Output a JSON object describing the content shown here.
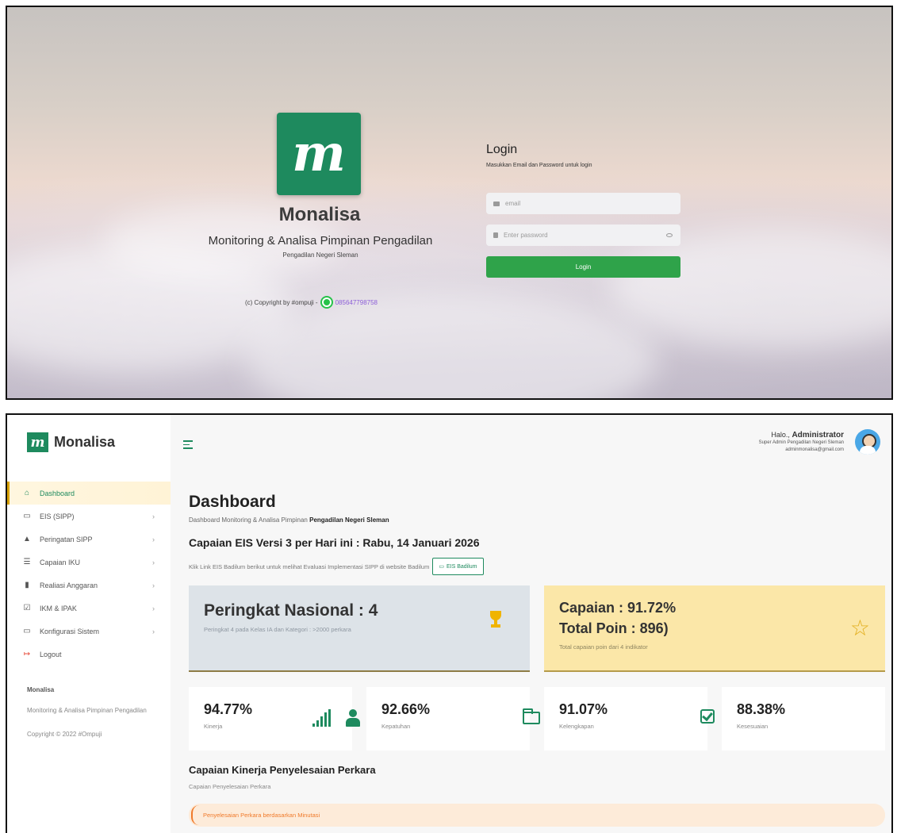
{
  "login": {
    "logo_letter": "m",
    "brand_name": "Monalisa",
    "brand_tagline": "Monitoring & Analisa Pimpinan Pengadilan",
    "court_name": "Pengadilan Negeri Sleman",
    "copyright_text": "(c) Copyright by #ompuji -",
    "phone": "085647798758",
    "title": "Login",
    "description": "Masukkan Email dan Password untuk login",
    "email_placeholder": "email",
    "password_placeholder": "Enter password",
    "submit_label": "Login",
    "colors": {
      "brand": "#1e8a5e",
      "button": "#2fa34a",
      "whatsapp": "#27c24a"
    }
  },
  "dashboard": {
    "sidebar": {
      "logo_letter": "m",
      "logo_text": "Monalisa",
      "items": [
        {
          "label": "Dashboard",
          "icon": "home-icon",
          "glyph": "⌂",
          "active": true,
          "chevron": ""
        },
        {
          "label": "EIS (SIPP)",
          "icon": "monitor-icon",
          "glyph": "▭",
          "active": false,
          "chevron": "›"
        },
        {
          "label": "Peringatan SIPP",
          "icon": "warning-icon",
          "glyph": "▲",
          "active": false,
          "chevron": "›"
        },
        {
          "label": "Capaian IKU",
          "icon": "list-icon",
          "glyph": "☰",
          "active": false,
          "chevron": "›"
        },
        {
          "label": "Realiasi Anggaran",
          "icon": "bar-chart-icon",
          "glyph": "▮",
          "active": false,
          "chevron": "›"
        },
        {
          "label": "IKM & IPAK",
          "icon": "checkbox-icon",
          "glyph": "☑",
          "active": false,
          "chevron": "›"
        },
        {
          "label": "Konfigurasi Sistem",
          "icon": "monitor-icon",
          "glyph": "▭",
          "active": false,
          "chevron": "›"
        },
        {
          "label": "Logout",
          "icon": "logout-icon",
          "glyph": "↦",
          "active": false,
          "chevron": ""
        }
      ],
      "footer_title": "Monalisa",
      "footer_desc": "Monitoring & Analisa Pimpinan Pengadilan",
      "footer_copy": "Copyright © 2022 #Ompuji"
    },
    "header": {
      "greeting_prefix": "Halo.,",
      "user_name": "Administrator",
      "role": "Super Admin Pengadilan Negeri Sleman",
      "email": "adminmonalisa@gmail.com"
    },
    "page_title": "Dashboard",
    "page_sub_prefix": "Dashboard Monitoring & Analisa Pimpinan",
    "page_sub_court": "Pengadilan Negeri Sleman",
    "eis_title": "Capaian EIS Versi 3 per Hari ini : Rabu, 14 Januari 2026",
    "eis_desc": "Klik Link EIS Badilum berikut untuk melihat Evaluasi Implementasi SIPP di website Badilum",
    "eis_button": "EIS Badilum",
    "rank_card": {
      "title": "Peringkat Nasional : 4",
      "desc": "Peringkat 4 pada Kelas IA dan Kategori : >2000 perkara"
    },
    "capaian_card": {
      "line1": "Capaian : 91.72%",
      "line2": "Total Poin : 896)",
      "desc": "Total capaian poin dari 4 indikator"
    },
    "stats": [
      {
        "value": "94.77%",
        "label": "Kinerja",
        "icon": "signal-bars-icon"
      },
      {
        "value": "92.66%",
        "label": "Kepatuhan",
        "icon": "user-icon"
      },
      {
        "value": "91.07%",
        "label": "Kelengkapan",
        "icon": "folder-open-icon"
      },
      {
        "value": "88.38%",
        "label": "Kesesuaian",
        "icon": "check-square-icon"
      }
    ],
    "perf_title": "Capaian Kinerja Penyelesaian Perkara",
    "perf_sub": "Capaian Penyelesaian Perkara",
    "alert_text": "Penyelesaian Perkara berdasarkan Minutasi",
    "colors": {
      "brand": "#1e8a5e",
      "active_accent": "#d9a200",
      "rank_bg": "#dde3e8",
      "capaian_bg": "#fbe7a8",
      "alert": "#f07a2a"
    }
  }
}
